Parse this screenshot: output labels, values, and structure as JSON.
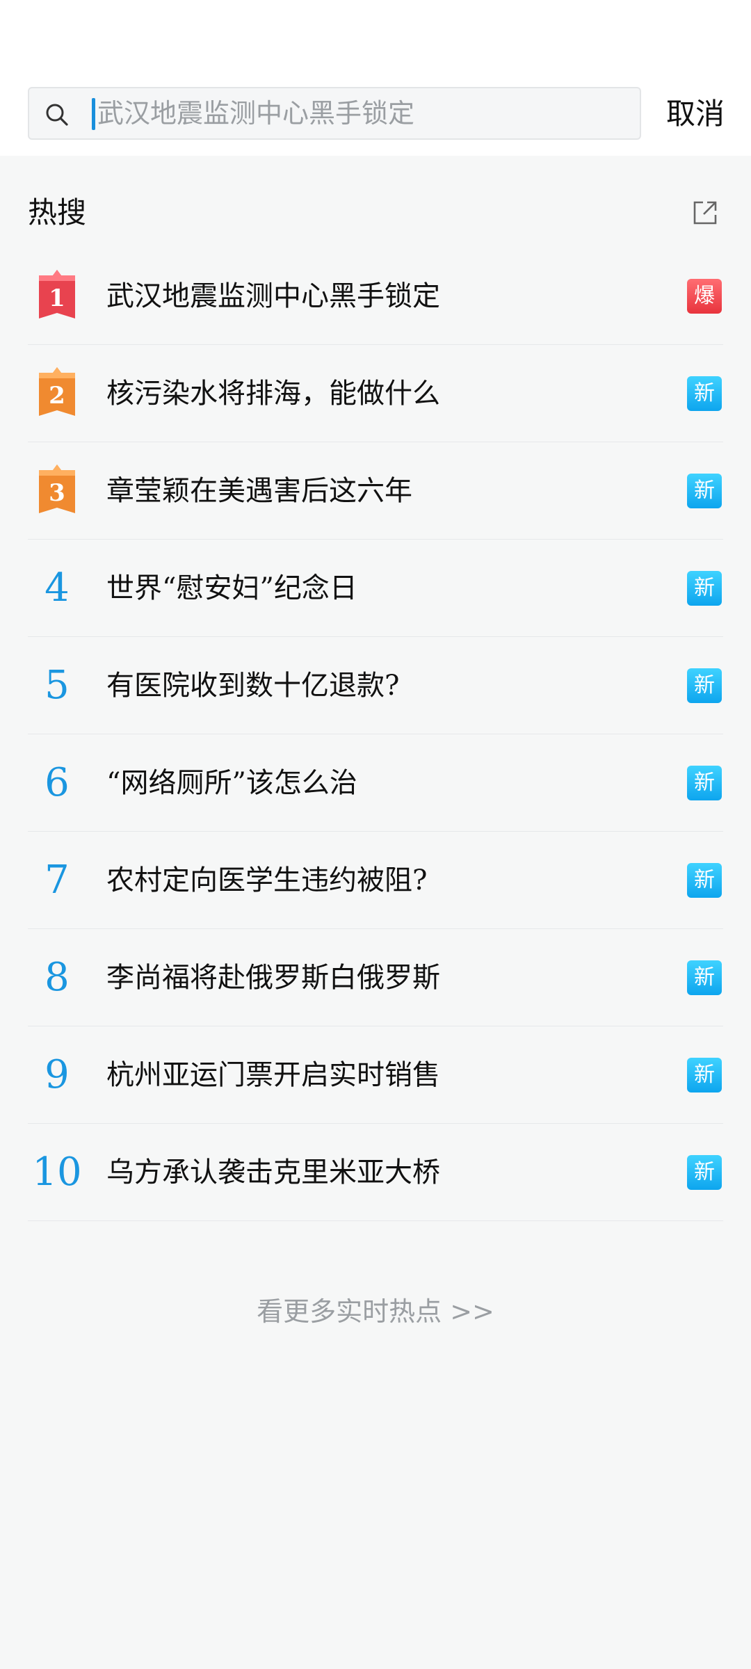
{
  "search": {
    "placeholder": "武汉地震监测中心黑手锁定",
    "value": "",
    "cancel_label": "取消"
  },
  "hot": {
    "title": "热搜",
    "items": [
      {
        "rank": "1",
        "title": "武汉地震监测中心黑手锁定",
        "badge": "爆",
        "badge_type": "hot",
        "medal": "red"
      },
      {
        "rank": "2",
        "title": "核污染水将排海，能做什么",
        "badge": "新",
        "badge_type": "new",
        "medal": "orange"
      },
      {
        "rank": "3",
        "title": "章莹颖在美遇害后这六年",
        "badge": "新",
        "badge_type": "new",
        "medal": "orange"
      },
      {
        "rank": "4",
        "title": "世界“慰安妇”纪念日",
        "badge": "新",
        "badge_type": "new"
      },
      {
        "rank": "5",
        "title": "有医院收到数十亿退款?",
        "badge": "新",
        "badge_type": "new"
      },
      {
        "rank": "6",
        "title": "“网络厕所”该怎么治",
        "badge": "新",
        "badge_type": "new"
      },
      {
        "rank": "7",
        "title": "农村定向医学生违约被阻?",
        "badge": "新",
        "badge_type": "new"
      },
      {
        "rank": "8",
        "title": "李尚福将赴俄罗斯白俄罗斯",
        "badge": "新",
        "badge_type": "new"
      },
      {
        "rank": "9",
        "title": "杭州亚运门票开启实时销售",
        "badge": "新",
        "badge_type": "new"
      },
      {
        "rank": "10",
        "title": "乌方承认袭击克里米亚大桥",
        "badge": "新",
        "badge_type": "new"
      }
    ],
    "more_label": "看更多实时热点 >>"
  },
  "colors": {
    "accent": "#1a96e0",
    "medal_red": "#e8434f",
    "medal_orange": "#f08a30",
    "badge_new": "#1ab0f0",
    "badge_hot": "#e8343d"
  },
  "icons": {
    "search": "search-icon",
    "share": "share-external-icon"
  }
}
